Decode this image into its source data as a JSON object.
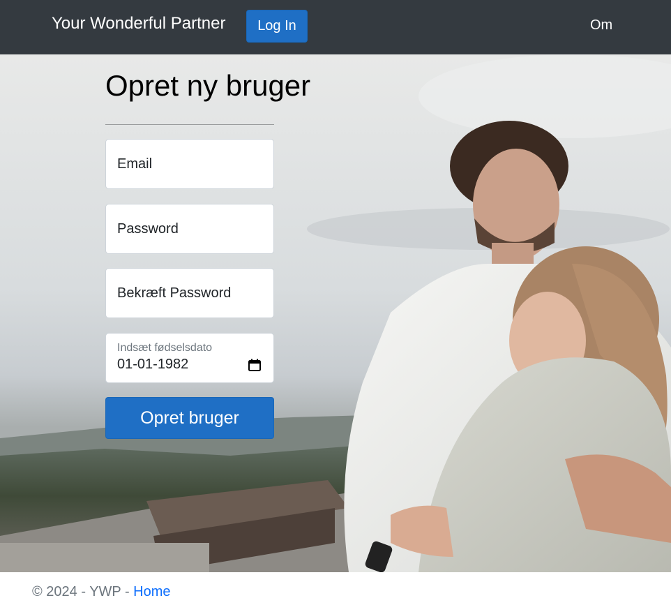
{
  "navbar": {
    "brand": "Your Wonderful Partner",
    "login_label": "Log In",
    "about_label": "Om"
  },
  "form": {
    "title": "Opret ny bruger",
    "email_label": "Email",
    "password_label": "Password",
    "confirm_password_label": "Bekræft Password",
    "birthdate_label": "Indsæt fødselsdato",
    "birthdate_value": "01-01-1982",
    "submit_label": "Opret bruger"
  },
  "footer": {
    "copyright": "© 2024 - YWP - ",
    "home_link": "Home"
  },
  "colors": {
    "navbar_bg": "#343a40",
    "primary": "#1f6fc5",
    "footer_link": "#0d6efd"
  },
  "icons": {
    "calendar": "calendar-icon"
  }
}
